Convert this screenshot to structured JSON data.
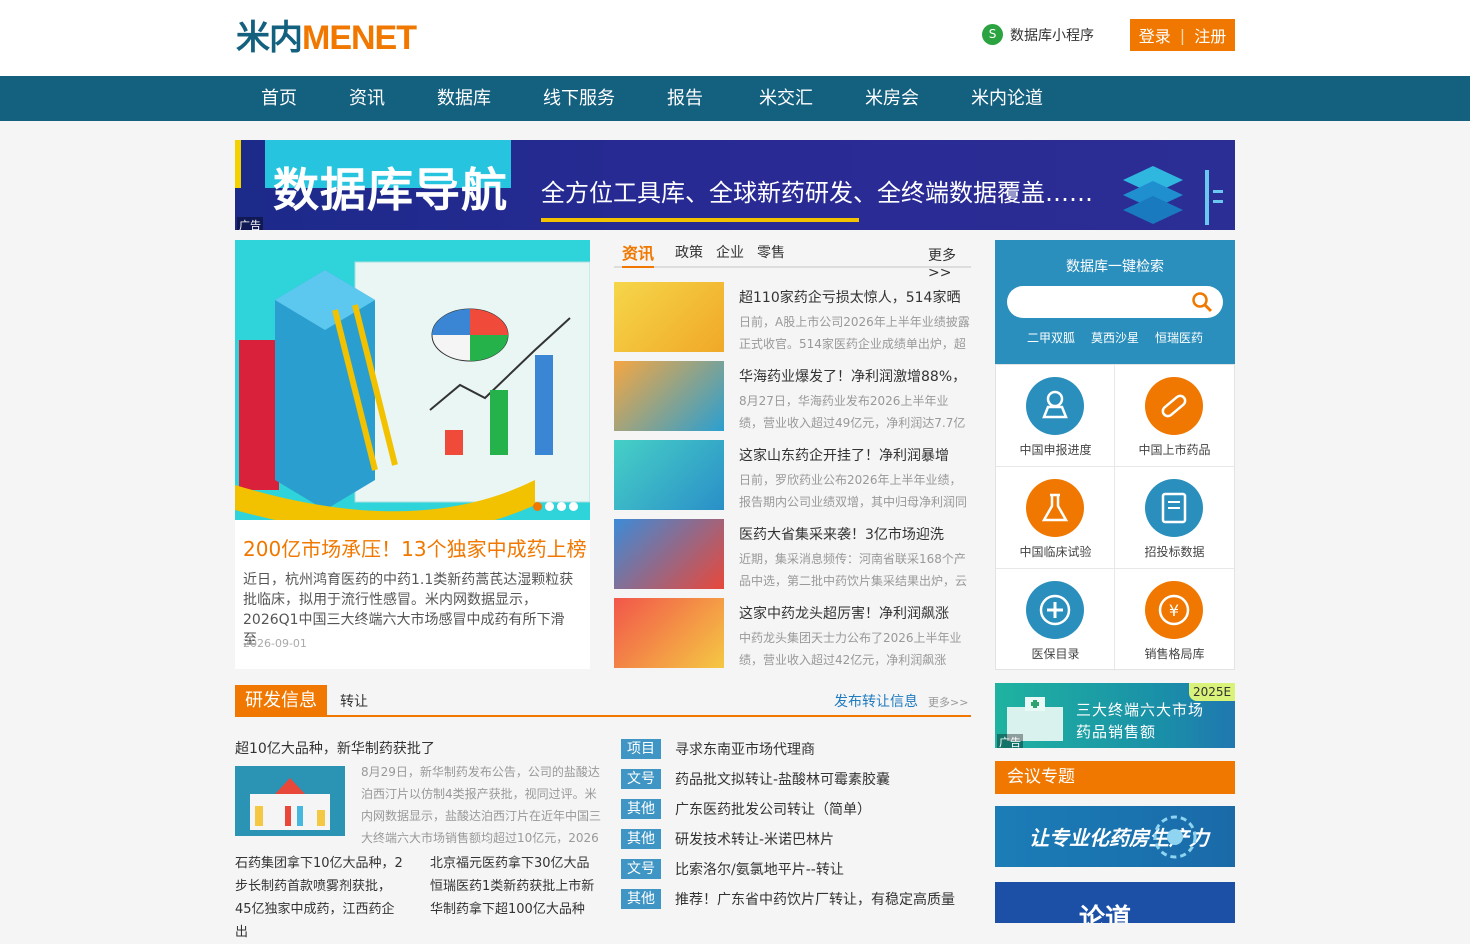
{
  "header": {
    "logo_cn": "米内",
    "logo_en": "MENET",
    "mini_program": "数据库小程序",
    "login": "登录",
    "register": "注册"
  },
  "nav": [
    "首页",
    "资讯",
    "数据库",
    "线下服务",
    "报告",
    "米交汇",
    "米房会",
    "米内论道"
  ],
  "banner": {
    "title": "数据库导航",
    "subtitle": "全方位工具库、全球新药研发、全终端数据覆盖……",
    "ad": "广告"
  },
  "hero": {
    "title": "200亿市场承压！13个独家中成药上榜",
    "desc": "近日，杭州鸿育医药的中药1.1类新药蒿芪达湿颗粒获批临床，拟用于流行性感冒。米内网数据显示，2026Q1中国三大终端六大市场感冒中成药有所下滑至",
    "date": "2026-09-01"
  },
  "news": {
    "tabs": [
      "资讯",
      "政策",
      "企业",
      "零售"
    ],
    "more": "更多>>",
    "items": [
      {
        "title": "超110家药企亏损太惊人，514家晒",
        "summary": "日前，A股上市公司2026年上半年业绩披露正式收官。514家医药企业成绩单出炉，超"
      },
      {
        "title": "华海药业爆发了！净利润激增88%，",
        "summary": "8月27日，华海药业发布2026上半年业绩，营业收入超过49亿元，净利润达7.7亿元。"
      },
      {
        "title": "这家山东药企开挂了！净利润暴增",
        "summary": "日前，罗欣药业公布2026年上半年业绩，报告期内公司业绩双增，其中归母净利润同"
      },
      {
        "title": "医药大省集采来袭！3亿市场迎洗",
        "summary": "近期，集采消息频传：河南省联采168个产品中选，第二批中药饮片集采结果出炉，云"
      },
      {
        "title": "这家中药龙头超厉害！净利润飙涨",
        "summary": "中药龙头集团天士力公布了2026上半年业绩，营业收入超过42亿元，净利润飙涨"
      }
    ]
  },
  "search": {
    "title": "数据库一键检索",
    "placeholder": "",
    "keywords": [
      "二甲双胍",
      "莫西沙星",
      "恒瑞医药"
    ]
  },
  "db_grid": [
    {
      "label": "中国申报进度",
      "icon": "stamp-icon"
    },
    {
      "label": "中国上市药品",
      "icon": "pill-icon"
    },
    {
      "label": "中国临床试验",
      "icon": "flask-icon"
    },
    {
      "label": "招投标数据",
      "icon": "document-check-icon"
    },
    {
      "label": "医保目录",
      "icon": "plus-circle-icon"
    },
    {
      "label": "销售格局库",
      "icon": "yen-icon"
    }
  ],
  "rd": {
    "tab_active": "研发信息",
    "tab2": "转让",
    "publish": "发布转让信息",
    "more": "更多>>",
    "lead": {
      "title": "超10亿大品种，新华制药获批了",
      "summary": "8月29日，新华制药发布公告，公司的盐酸达泊西汀片以仿制4类报产获批，视同过评。米内网数据显示，盐酸达泊西汀片在近年中国三大终端六大市场销售额均超过10亿元，2026"
    },
    "left_text": "石药集团拿下10亿大品种，2步长制药首款喷雾剂获批，45亿独家中成药，江西药企出",
    "right_text": "北京福元医药拿下30亿大品恒瑞医药1类新药获批上市新华制药拿下超100亿大品种"
  },
  "transfers": [
    {
      "tag": "项目",
      "text": "寻求东南亚市场代理商"
    },
    {
      "tag": "文号",
      "text": "药品批文拟转让-盐酸林可霉素胶囊"
    },
    {
      "tag": "其他",
      "text": "广东医药批发公司转让（简单）"
    },
    {
      "tag": "其他",
      "text": "研发技术转让-米诺巴林片"
    },
    {
      "tag": "文号",
      "text": "比索洛尔/氨氯地平片--转让"
    },
    {
      "tag": "其他",
      "text": "推荐！广东省中药饮片厂转让，有稳定高质量"
    }
  ],
  "side_ad": {
    "year": "2025E",
    "line1": "三大终端六大市场",
    "line2": "药品销售额",
    "ad": "广告"
  },
  "meeting": {
    "title": "会议专题"
  },
  "ad3": {
    "text": "让专业化药房生产力"
  },
  "ad4": {
    "text": "论道"
  },
  "colors": {
    "brand_blue": "#14607f",
    "accent_orange": "#f07800",
    "tag_blue": "#3f95c4"
  }
}
